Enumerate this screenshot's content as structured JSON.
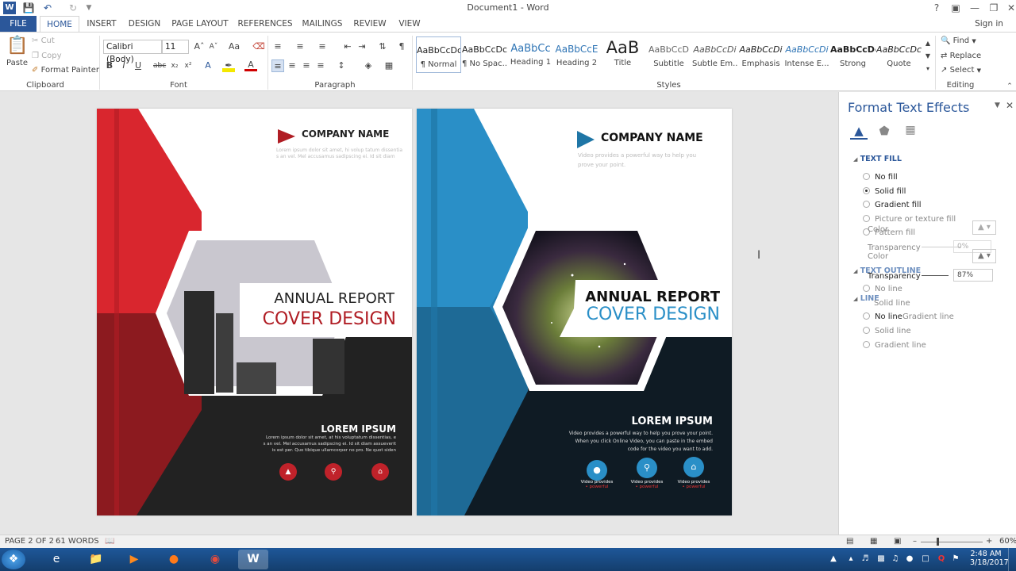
{
  "titlebar": {
    "title": "Document1 - Word",
    "help": "?",
    "signin": "Sign in"
  },
  "tabs": [
    "FILE",
    "HOME",
    "INSERT",
    "DESIGN",
    "PAGE LAYOUT",
    "REFERENCES",
    "MAILINGS",
    "REVIEW",
    "VIEW"
  ],
  "ribbon": {
    "clipboard": {
      "paste": "Paste",
      "cut": "Cut",
      "copy": "Copy",
      "format_painter": "Format Painter",
      "label": "Clipboard"
    },
    "font": {
      "name": "Calibri (Body)",
      "size": "11",
      "label": "Font",
      "aa": "Aa"
    },
    "paragraph": {
      "label": "Paragraph"
    },
    "styles": {
      "label": "Styles",
      "items": [
        {
          "preview": "AaBbCcDc",
          "name": "¶ Normal"
        },
        {
          "preview": "AaBbCcDc",
          "name": "¶ No Spac..."
        },
        {
          "preview": "AaBbCc",
          "name": "Heading 1"
        },
        {
          "preview": "AaBbCcE",
          "name": "Heading 2"
        },
        {
          "preview": "AaB",
          "name": "Title"
        },
        {
          "preview": "AaBbCcD",
          "name": "Subtitle"
        },
        {
          "preview": "AaBbCcDi",
          "name": "Subtle Em..."
        },
        {
          "preview": "AaBbCcDi",
          "name": "Emphasis"
        },
        {
          "preview": "AaBbCcDi",
          "name": "Intense E..."
        },
        {
          "preview": "AaBbCcDc",
          "name": "Strong"
        },
        {
          "preview": "AaBbCcDc",
          "name": "Quote"
        }
      ]
    },
    "editing": {
      "find": "Find",
      "replace": "Replace",
      "select": "Select",
      "label": "Editing"
    }
  },
  "pages": {
    "red": {
      "company": "COMPANY NAME",
      "tagline1": "Lorem ipsum dolor sit amet, hi volup tatum dissentia",
      "tagline2": "s an vel. Mel accusamus sadipscing ei. Id sit diam",
      "title1": "ANNUAL REPORT",
      "title2": "COVER DESIGN",
      "lorem": "LOREM IPSUM",
      "body1": "Lorem ipsum dolor sit amet, at his voluptatum dissentias, e",
      "body2": "s an vel. Mel accusamus sadipscing ei. Id sit diam assueverit",
      "body3": "is est per. Quo tibique ullamcorper no pro. Ne quot siden"
    },
    "blue": {
      "company": "COMPANY NAME",
      "tagline1": "Video provides a powerful way to help you",
      "tagline2": "prove your point.",
      "title1": "ANNUAL REPORT",
      "title2": "COVER DESIGN",
      "lorem": "LOREM IPSUM",
      "body1": "Video provides a powerful way to help you prove your point.",
      "body2": "When you click Online Video, you can paste in the embed",
      "body3": "code for the video you want to add.",
      "icon_label1": "Video provides",
      "icon_label2": "• powerful"
    }
  },
  "pane": {
    "title": "Format Text Effects",
    "text_fill": "TEXT FILL",
    "no_fill": "No fill",
    "solid_fill": "Solid fill",
    "gradient_fill": "Gradient fill",
    "picture_fill": "Picture or texture fill",
    "pattern_fill": "Pattern fill",
    "color": "Color",
    "transparency": "Transparency",
    "transparency1": "0%",
    "transparency2": "87%",
    "text_outline": "TEXT OUTLINE",
    "line": "LINE",
    "no_line": "No line",
    "solid_line": "Solid line",
    "gradient_line": "Gradient line"
  },
  "status": {
    "page": "PAGE 2 OF 2",
    "words": "61 WORDS",
    "zoom": "60%"
  },
  "taskbar": {
    "time": "2:48 AM",
    "date": "3/18/2017"
  },
  "colors": {
    "accent": "#2b579a",
    "red": "#d9262e",
    "blue": "#2a8fc7",
    "dark": "#1f1f1f",
    "navy": "#0f1b24"
  }
}
